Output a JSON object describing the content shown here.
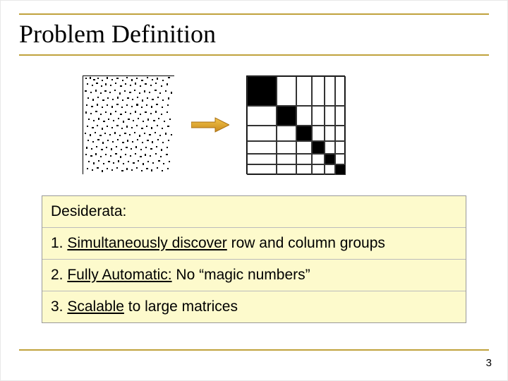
{
  "slide": {
    "title": "Problem Definition",
    "page_number": "3"
  },
  "figure": {
    "left_matrix_desc": "dense-noise-matrix",
    "arrow_desc": "transforms-to",
    "right_matrix_desc": "block-diagonal-matrix"
  },
  "desiderata": {
    "heading": "Desiderata:",
    "items": [
      {
        "prefix": "1. ",
        "emphasis": "Simultaneously discover",
        "rest": " row and column groups"
      },
      {
        "prefix": "2. ",
        "emphasis": "Fully Automatic:",
        "rest": " No “magic numbers”"
      },
      {
        "prefix": "3. ",
        "emphasis": "Scalable",
        "rest": " to large matrices"
      }
    ]
  }
}
